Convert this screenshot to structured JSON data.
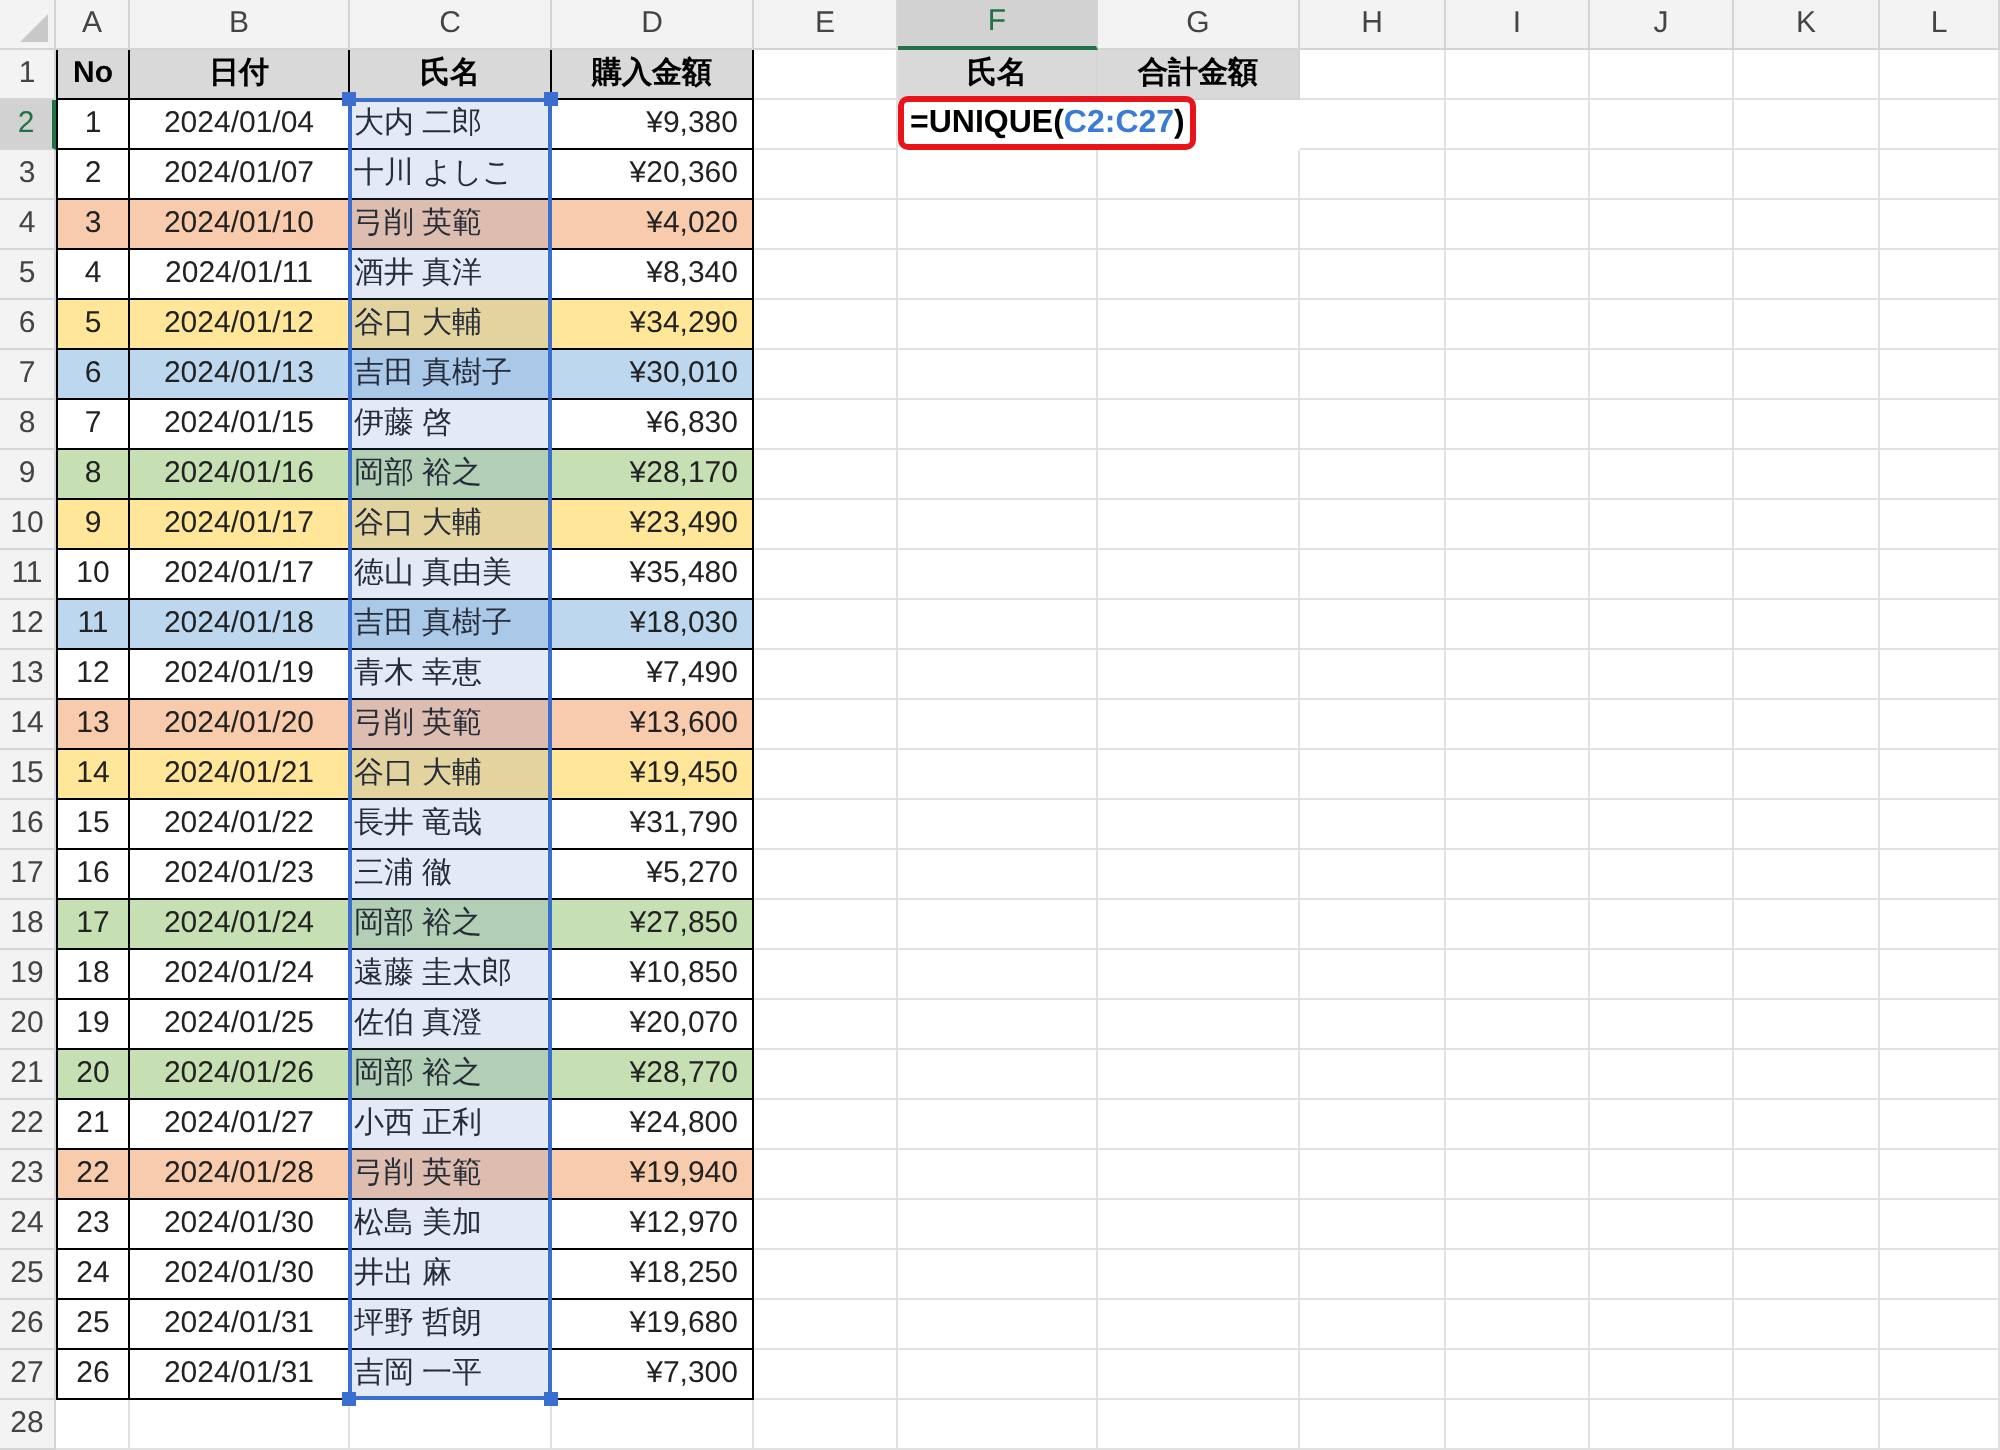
{
  "column_headers": [
    {
      "label": "A",
      "selected": false
    },
    {
      "label": "B",
      "selected": false
    },
    {
      "label": "C",
      "selected": false
    },
    {
      "label": "D",
      "selected": false
    },
    {
      "label": "E",
      "selected": false
    },
    {
      "label": "F",
      "selected": true
    },
    {
      "label": "G",
      "selected": false
    },
    {
      "label": "H",
      "selected": false
    },
    {
      "label": "I",
      "selected": false
    },
    {
      "label": "J",
      "selected": false
    },
    {
      "label": "K",
      "selected": false
    },
    {
      "label": "L",
      "selected": false
    }
  ],
  "row_numbers": [
    {
      "label": "1",
      "selected": false
    },
    {
      "label": "2",
      "selected": true
    },
    {
      "label": "3",
      "selected": false
    },
    {
      "label": "4",
      "selected": false
    },
    {
      "label": "5",
      "selected": false
    },
    {
      "label": "6",
      "selected": false
    },
    {
      "label": "7",
      "selected": false
    },
    {
      "label": "8",
      "selected": false
    },
    {
      "label": "9",
      "selected": false
    },
    {
      "label": "10",
      "selected": false
    },
    {
      "label": "11",
      "selected": false
    },
    {
      "label": "12",
      "selected": false
    },
    {
      "label": "13",
      "selected": false
    },
    {
      "label": "14",
      "selected": false
    },
    {
      "label": "15",
      "selected": false
    },
    {
      "label": "16",
      "selected": false
    },
    {
      "label": "17",
      "selected": false
    },
    {
      "label": "18",
      "selected": false
    },
    {
      "label": "19",
      "selected": false
    },
    {
      "label": "20",
      "selected": false
    },
    {
      "label": "21",
      "selected": false
    },
    {
      "label": "22",
      "selected": false
    },
    {
      "label": "23",
      "selected": false
    },
    {
      "label": "24",
      "selected": false
    },
    {
      "label": "25",
      "selected": false
    },
    {
      "label": "26",
      "selected": false
    },
    {
      "label": "27",
      "selected": false
    },
    {
      "label": "28",
      "selected": false
    }
  ],
  "table": {
    "columns": [
      {
        "label": "No",
        "referenced": false
      },
      {
        "label": "日付",
        "referenced": false
      },
      {
        "label": "氏名",
        "referenced": true
      },
      {
        "label": "購入金額",
        "referenced": false
      }
    ],
    "rows": [
      {
        "cells": [
          "1",
          "2024/01/04",
          "大内 二郎",
          "¥9,380"
        ],
        "color": "#ffffff"
      },
      {
        "cells": [
          "2",
          "2024/01/07",
          "十川 よしこ",
          "¥20,360"
        ],
        "color": "#ffffff"
      },
      {
        "cells": [
          "3",
          "2024/01/10",
          "弓削 英範",
          "¥4,020"
        ],
        "color": "#f8cbad"
      },
      {
        "cells": [
          "4",
          "2024/01/11",
          "酒井 真洋",
          "¥8,340"
        ],
        "color": "#ffffff"
      },
      {
        "cells": [
          "5",
          "2024/01/12",
          "谷口 大輔",
          "¥34,290"
        ],
        "color": "#ffe699"
      },
      {
        "cells": [
          "6",
          "2024/01/13",
          "吉田 真樹子",
          "¥30,010"
        ],
        "color": "#bdd7ee"
      },
      {
        "cells": [
          "7",
          "2024/01/15",
          "伊藤 啓",
          "¥6,830"
        ],
        "color": "#ffffff"
      },
      {
        "cells": [
          "8",
          "2024/01/16",
          "岡部 裕之",
          "¥28,170"
        ],
        "color": "#c6e0b4"
      },
      {
        "cells": [
          "9",
          "2024/01/17",
          "谷口 大輔",
          "¥23,490"
        ],
        "color": "#ffe699"
      },
      {
        "cells": [
          "10",
          "2024/01/17",
          "徳山 真由美",
          "¥35,480"
        ],
        "color": "#ffffff"
      },
      {
        "cells": [
          "11",
          "2024/01/18",
          "吉田 真樹子",
          "¥18,030"
        ],
        "color": "#bdd7ee"
      },
      {
        "cells": [
          "12",
          "2024/01/19",
          "青木 幸恵",
          "¥7,490"
        ],
        "color": "#ffffff"
      },
      {
        "cells": [
          "13",
          "2024/01/20",
          "弓削 英範",
          "¥13,600"
        ],
        "color": "#f8cbad"
      },
      {
        "cells": [
          "14",
          "2024/01/21",
          "谷口 大輔",
          "¥19,450"
        ],
        "color": "#ffe699"
      },
      {
        "cells": [
          "15",
          "2024/01/22",
          "長井 竜哉",
          "¥31,790"
        ],
        "color": "#ffffff"
      },
      {
        "cells": [
          "16",
          "2024/01/23",
          "三浦 徹",
          "¥5,270"
        ],
        "color": "#ffffff"
      },
      {
        "cells": [
          "17",
          "2024/01/24",
          "岡部 裕之",
          "¥27,850"
        ],
        "color": "#c6e0b4"
      },
      {
        "cells": [
          "18",
          "2024/01/24",
          "遠藤 圭太郎",
          "¥10,850"
        ],
        "color": "#ffffff"
      },
      {
        "cells": [
          "19",
          "2024/01/25",
          "佐伯 真澄",
          "¥20,070"
        ],
        "color": "#ffffff"
      },
      {
        "cells": [
          "20",
          "2024/01/26",
          "岡部 裕之",
          "¥28,770"
        ],
        "color": "#c6e0b4"
      },
      {
        "cells": [
          "21",
          "2024/01/27",
          "小西 正利",
          "¥24,800"
        ],
        "color": "#ffffff"
      },
      {
        "cells": [
          "22",
          "2024/01/28",
          "弓削 英範",
          "¥19,940"
        ],
        "color": "#f8cbad"
      },
      {
        "cells": [
          "23",
          "2024/01/30",
          "松島 美加",
          "¥12,970"
        ],
        "color": "#ffffff"
      },
      {
        "cells": [
          "24",
          "2024/01/30",
          "井出 麻",
          "¥18,250"
        ],
        "color": "#ffffff"
      },
      {
        "cells": [
          "25",
          "2024/01/31",
          "坪野 哲朗",
          "¥19,680"
        ],
        "color": "#ffffff"
      },
      {
        "cells": [
          "26",
          "2024/01/31",
          "吉岡 一平",
          "¥7,300"
        ],
        "color": "#ffffff"
      }
    ]
  },
  "summary": {
    "columns": [
      "氏名",
      "合計金額"
    ],
    "formula": {
      "prefix": "=UNIQUE(",
      "reference": "C2:C27",
      "suffix": ")"
    }
  }
}
